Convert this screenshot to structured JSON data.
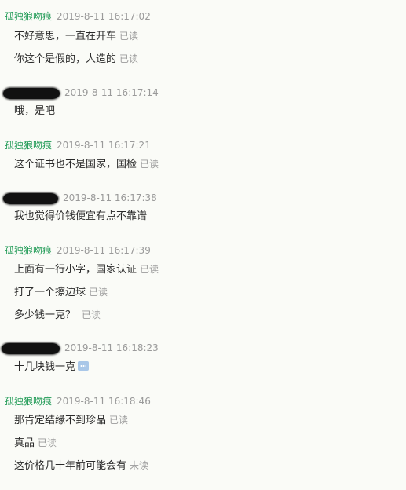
{
  "chat": {
    "groups": [
      {
        "sender": "孤独狼吻痕",
        "redacted": false,
        "timestamp": "2019-8-11 16:17:02",
        "messages": [
          {
            "text": "不好意思，一直在开车",
            "status": "已读"
          },
          {
            "text": "你这个是假的，人造的",
            "status": "已读"
          }
        ]
      },
      {
        "sender": "",
        "redacted": true,
        "timestamp": "2019-8-11 16:17:14",
        "messages": [
          {
            "text": "哦，是吧",
            "status": ""
          }
        ]
      },
      {
        "sender": "孤独狼吻痕",
        "redacted": false,
        "timestamp": "2019-8-11 16:17:21",
        "messages": [
          {
            "text": "这个证书也不是国家，国检",
            "status": "已读"
          }
        ]
      },
      {
        "sender": "",
        "redacted": true,
        "timestamp": "2019-8-11 16:17:38",
        "messages": [
          {
            "text": "我也觉得价钱便宜有点不靠谱",
            "status": ""
          }
        ]
      },
      {
        "sender": "孤独狼吻痕",
        "redacted": false,
        "timestamp": "2019-8-11 16:17:39",
        "messages": [
          {
            "text": "上面有一行小字，国家认证",
            "status": "已读"
          },
          {
            "text": "打了一个擦边球",
            "status": "已读"
          },
          {
            "text": "多少钱一克？",
            "status": "已读"
          }
        ]
      },
      {
        "sender": "",
        "redacted": true,
        "timestamp": "2019-8-11 16:18:23",
        "messages": [
          {
            "text": "十几块钱一克",
            "status": "",
            "emoji": "ellipsis-emoji-icon"
          }
        ]
      },
      {
        "sender": "孤独狼吻痕",
        "redacted": false,
        "timestamp": "2019-8-11 16:18:46",
        "messages": [
          {
            "text": "那肯定结缘不到珍品",
            "status": "已读"
          },
          {
            "text": "真品",
            "status": "已读"
          },
          {
            "text": "这价格几十年前可能会有",
            "status": "未读"
          }
        ]
      }
    ]
  }
}
